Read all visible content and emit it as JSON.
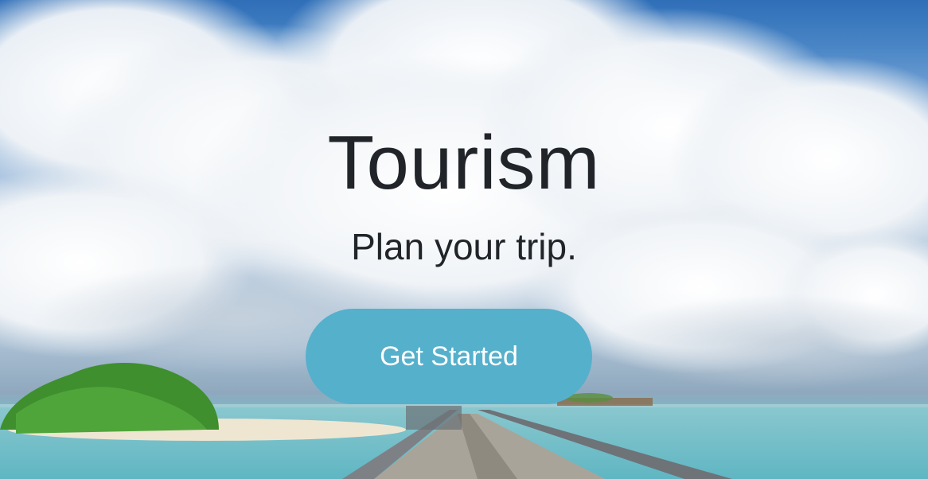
{
  "hero": {
    "title": "Tourism",
    "subtitle": "Plan your trip.",
    "button_label": "Get Started"
  },
  "colors": {
    "title_text": "#212529",
    "button_bg": "#55b0cc",
    "button_text": "#ffffff"
  }
}
